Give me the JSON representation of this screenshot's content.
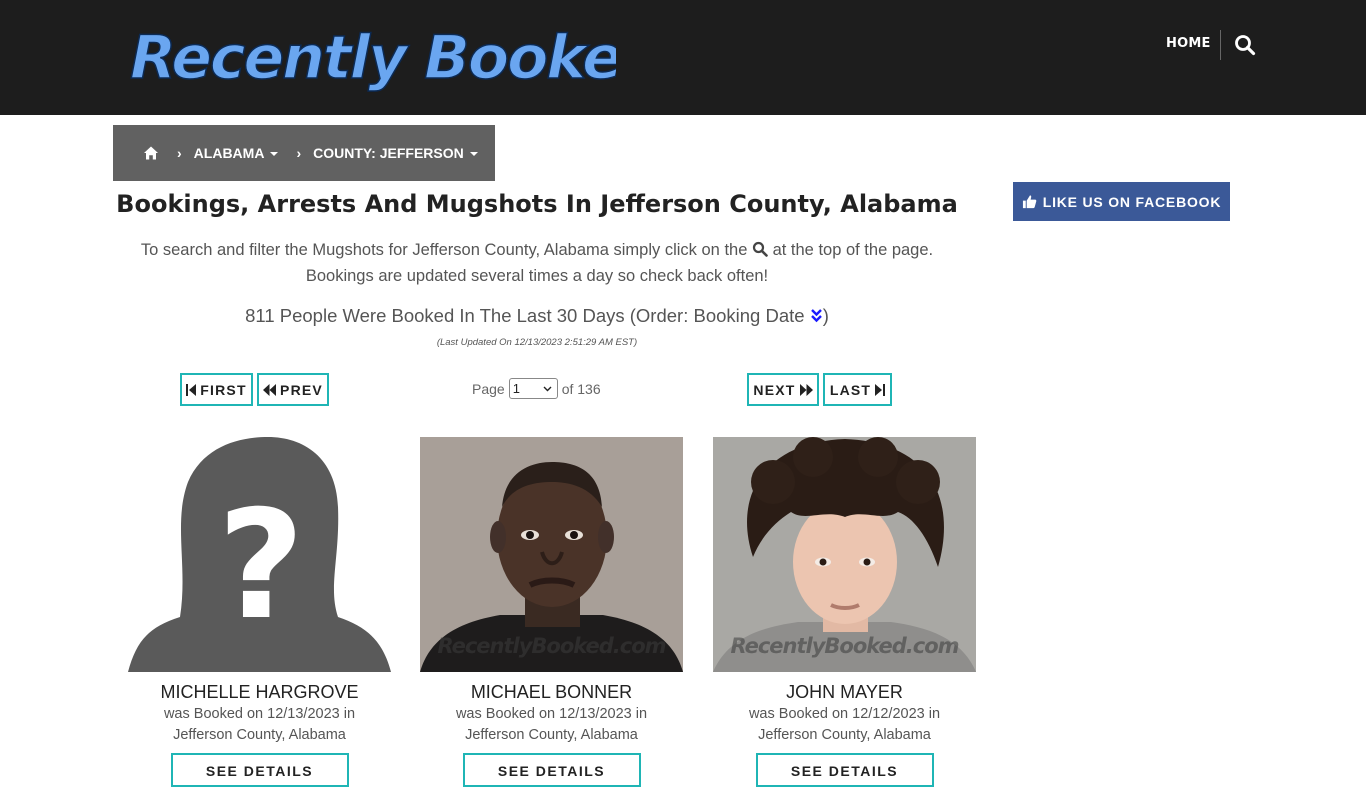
{
  "header": {
    "logo_text": "Recently Booked",
    "nav_home": "HOME",
    "search_icon": "search-icon"
  },
  "breadcrumb": {
    "home_icon": "home-icon",
    "state": "ALABAMA",
    "county": "COUNTY: JEFFERSON"
  },
  "facebook": {
    "label": "LIKE US ON FACEBOOK",
    "icon": "thumbs-up-icon"
  },
  "main": {
    "title": "Bookings, Arrests And Mugshots In Jefferson County, Alabama",
    "intro_part1": "To search and filter the Mugshots for Jefferson County, Alabama simply click on the",
    "intro_part2": "at the top of the page.",
    "intro_line2": "Bookings are updated several times a day so check back often!",
    "count_text": "811 People Were Booked In The Last 30 Days (Order: Booking Date",
    "count_close": ")",
    "updated": "(Last Updated On 12/13/2023 2:51:29 AM EST)"
  },
  "pager": {
    "first": "FIRST",
    "prev": "PREV",
    "next": "NEXT",
    "last": "LAST",
    "page_label": "Page",
    "current_page": "1",
    "of_label": "of 136"
  },
  "cards": [
    {
      "name": "MICHELLE HARGROVE",
      "booked": "was Booked on 12/13/2023 in",
      "location": "Jefferson County, Alabama",
      "button": "SEE DETAILS",
      "watermark": ""
    },
    {
      "name": "MICHAEL BONNER",
      "booked": "was Booked on 12/13/2023 in",
      "location": "Jefferson County, Alabama",
      "button": "SEE DETAILS",
      "watermark": "RecentlyBooked.com"
    },
    {
      "name": "JOHN MAYER",
      "booked": "was Booked on 12/12/2023 in",
      "location": "Jefferson County, Alabama",
      "button": "SEE DETAILS",
      "watermark": "RecentlyBooked.com"
    }
  ],
  "colors": {
    "header_bg": "#1d1d1d",
    "breadcrumb_bg": "#616161",
    "facebook_bg": "#3b5998",
    "accent_teal": "#1fb5b5"
  }
}
